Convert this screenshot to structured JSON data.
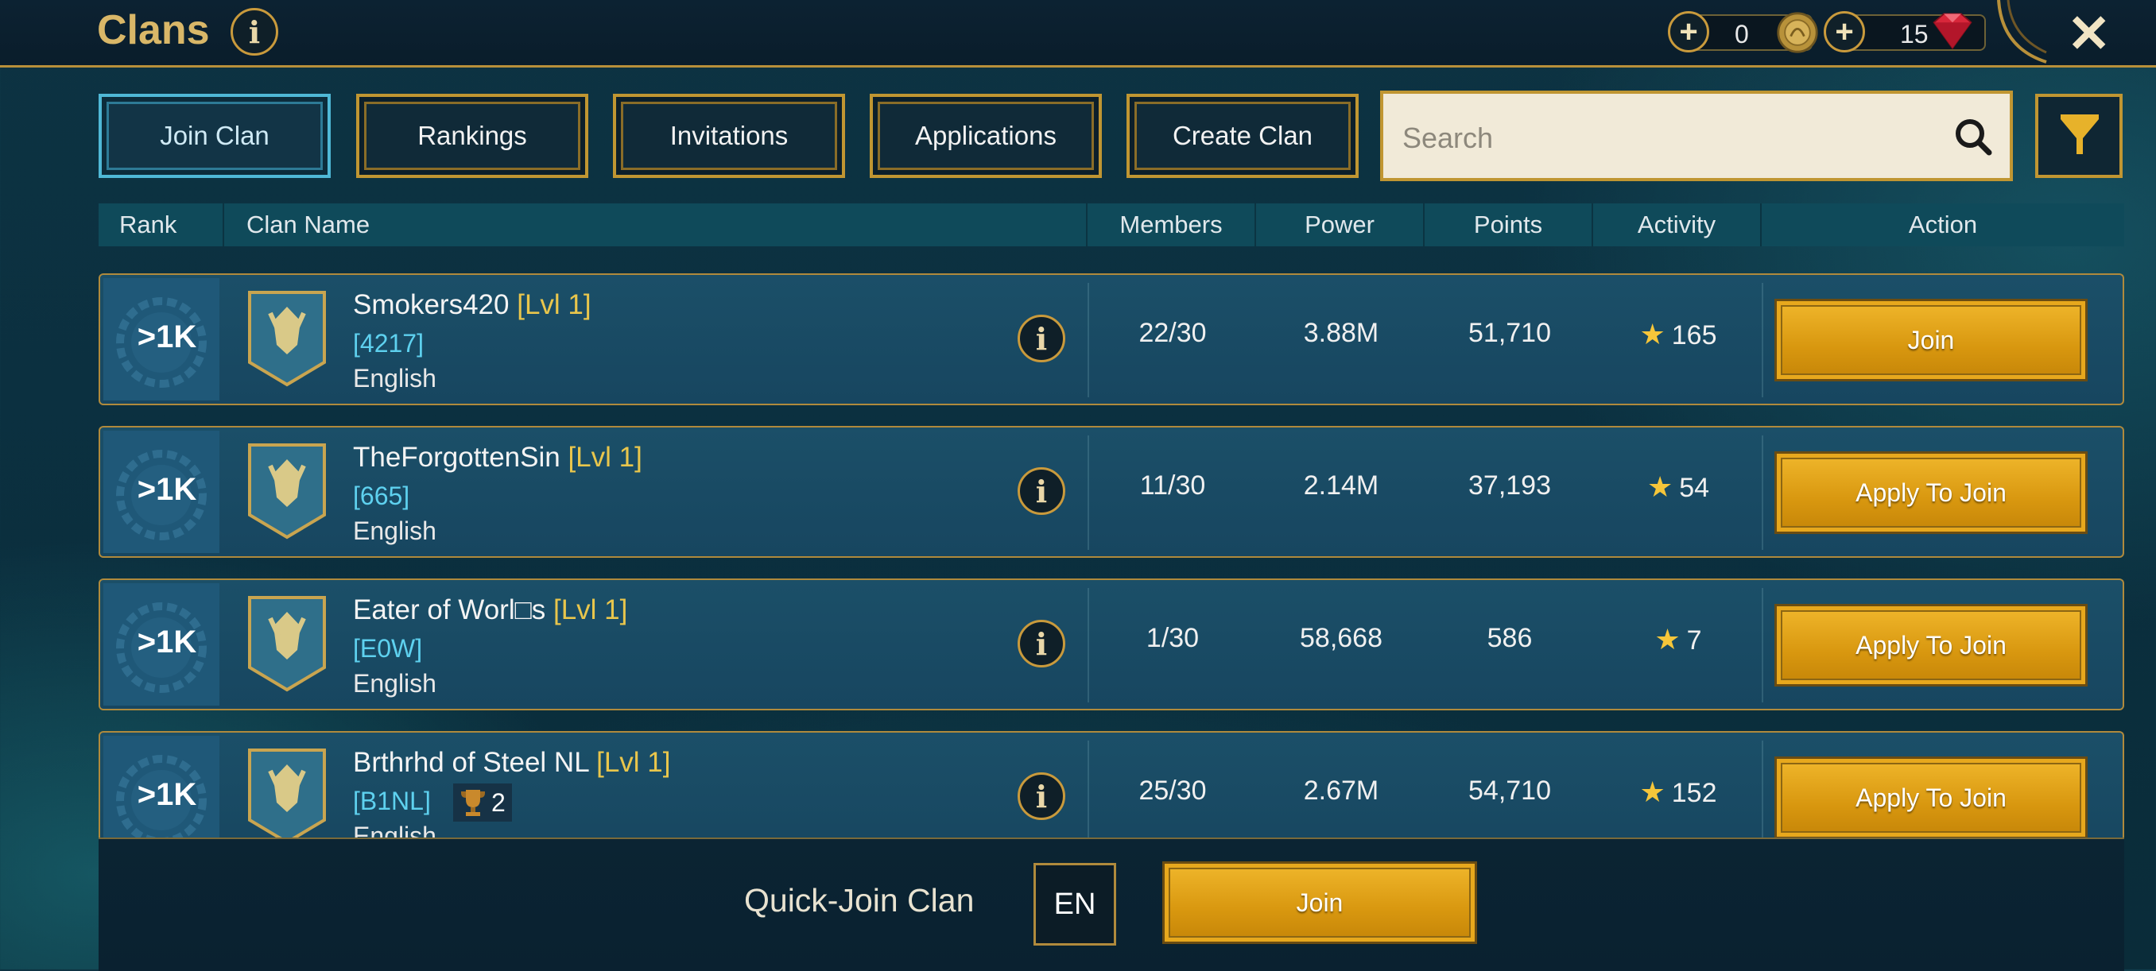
{
  "header": {
    "title": "Clans",
    "info_label": "i",
    "currency": [
      {
        "name": "gold",
        "value": "0",
        "icon": "gold-coin-icon"
      },
      {
        "name": "gems",
        "value": "15",
        "icon": "red-gem-icon"
      }
    ],
    "plus_label": "+",
    "close_label": "✕"
  },
  "tabs": [
    {
      "label": "Join Clan",
      "active": true
    },
    {
      "label": "Rankings",
      "active": false
    },
    {
      "label": "Invitations",
      "active": false
    },
    {
      "label": "Applications",
      "active": false
    },
    {
      "label": "Create Clan",
      "active": false
    }
  ],
  "search": {
    "placeholder": "Search",
    "value": ""
  },
  "table": {
    "columns": [
      "Rank",
      "Clan Name",
      "Members",
      "Power",
      "Points",
      "Activity",
      "Action"
    ],
    "rows": [
      {
        "rank": ">1K",
        "name": "Smokers420",
        "level": "[Lvl 1]",
        "tag": "[4217]",
        "language": "English",
        "members": "22/30",
        "power": "3.88M",
        "points": "51,710",
        "activity": "165",
        "action": "Join",
        "trophies": ""
      },
      {
        "rank": ">1K",
        "name": "TheForgottenSin",
        "level": "[Lvl 1]",
        "tag": "[665]",
        "language": "English",
        "members": "11/30",
        "power": "2.14M",
        "points": "37,193",
        "activity": "54",
        "action": "Apply To Join",
        "trophies": ""
      },
      {
        "rank": ">1K",
        "name": "Eater of Worl□s",
        "level": "[Lvl 1]",
        "tag": "[E0W]",
        "language": "English",
        "members": "1/30",
        "power": "58,668",
        "points": "586",
        "activity": "7",
        "action": "Apply To Join",
        "trophies": ""
      },
      {
        "rank": ">1K",
        "name": "Brthrhd of Steel NL",
        "level": "[Lvl 1]",
        "tag": "[B1NL]",
        "language": "English",
        "members": "25/30",
        "power": "2.67M",
        "points": "54,710",
        "activity": "152",
        "action": "Apply To Join",
        "trophies": "2"
      }
    ]
  },
  "quick_join": {
    "label": "Quick-Join Clan",
    "language": "EN",
    "button": "Join"
  },
  "colors": {
    "gold": "#c09632",
    "accent_blue": "#4fb8d6",
    "button_gold": "#e0a01a",
    "tag_cyan": "#5ed1ef",
    "level_yellow": "#e9c64c"
  }
}
